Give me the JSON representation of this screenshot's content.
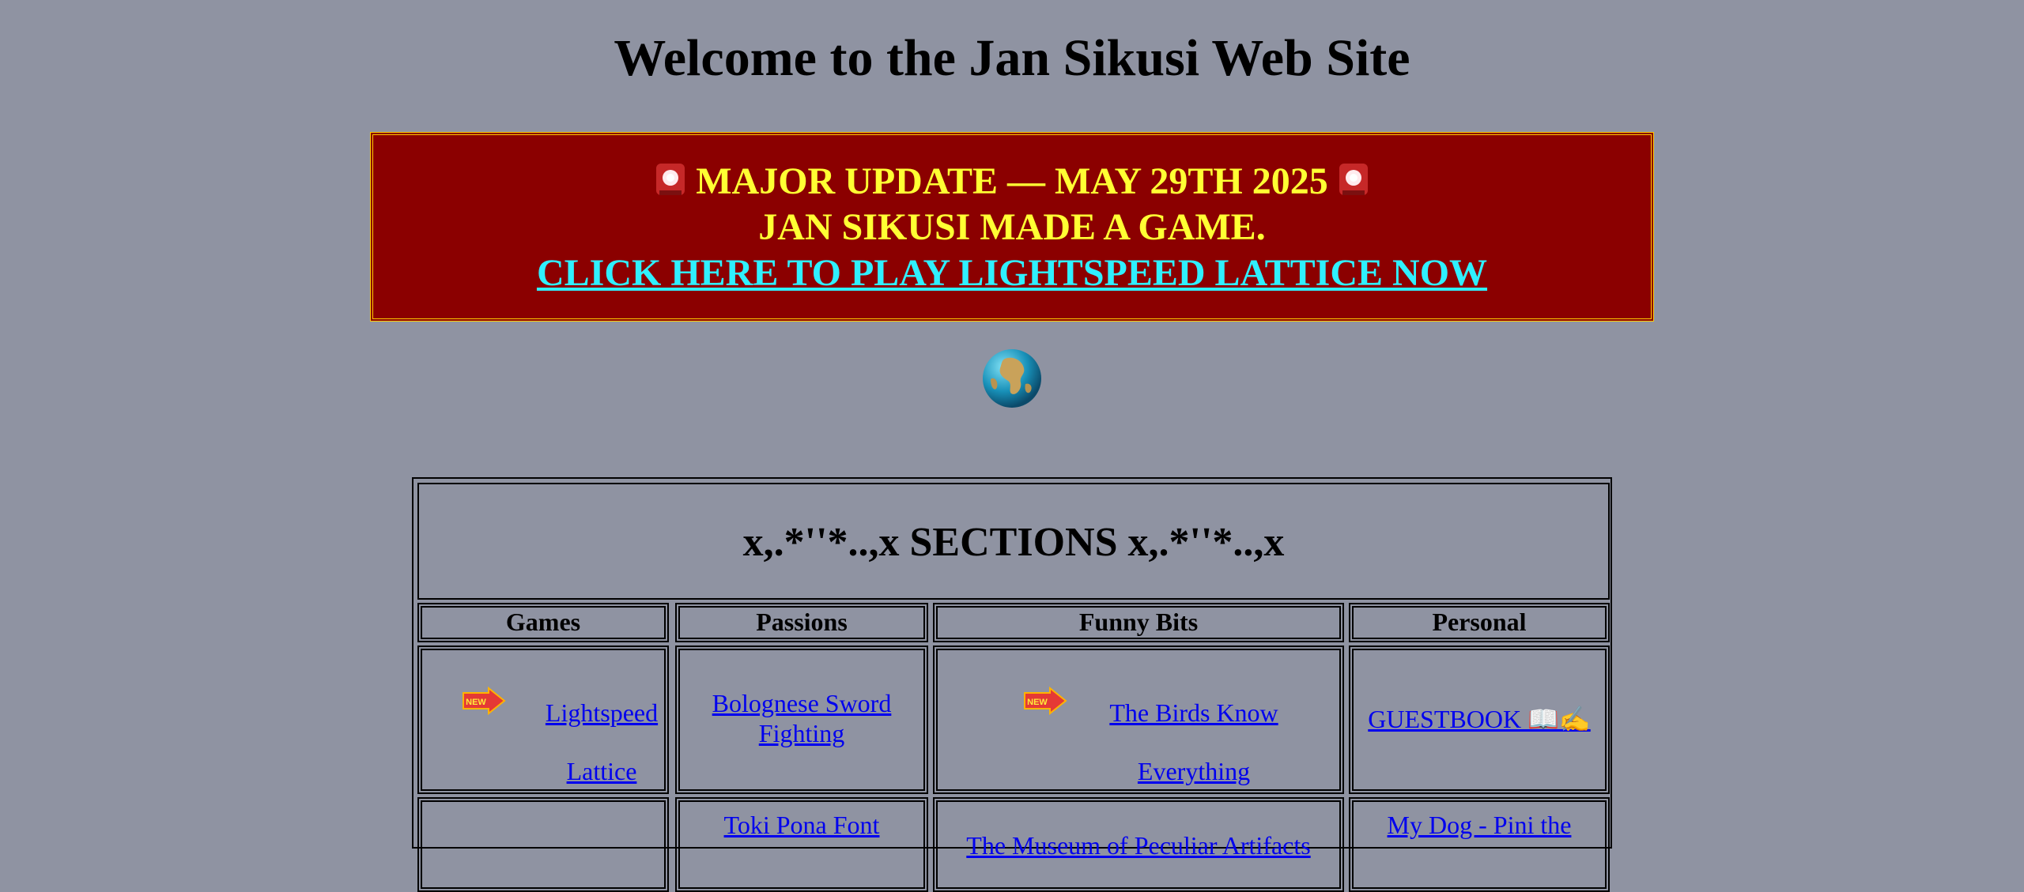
{
  "page": {
    "title": "Welcome to the Jan Sikusi Web Site"
  },
  "banner": {
    "line1": "MAJOR UPDATE — MAY 29TH 2025",
    "line2": "JAN SIKUSI MADE A GAME.",
    "cta": "CLICK HERE TO PLAY LIGHTSPEED LATTICE NOW",
    "colors": {
      "background": "#8b0000",
      "text": "#ffff33",
      "link": "#2ff0ff",
      "border": "#ffcc00"
    }
  },
  "sections": {
    "heading": "x,.*''*..,x SECTIONS x,.*''*..,x",
    "columns": [
      "Games",
      "Passions",
      "Funny Bits",
      "Personal"
    ],
    "row1": {
      "games": "Lightspeed Lattice",
      "passions": "Bolognese Sword Fighting",
      "funny": "The Birds Know Everything",
      "personal": "GUESTBOOK 📖✍️"
    },
    "row2": {
      "passions": "Toki Pona Font",
      "funny": "The Museum of Peculiar Artifacts",
      "personal": "My Dog - Pini the"
    },
    "new_badge": "NEW"
  },
  "colors": {
    "page_background": "#8f93a2",
    "link": "#0000ee"
  },
  "icons": {
    "siren": "siren-icon",
    "globe": "globe-icon",
    "new": "new-arrow-icon"
  }
}
